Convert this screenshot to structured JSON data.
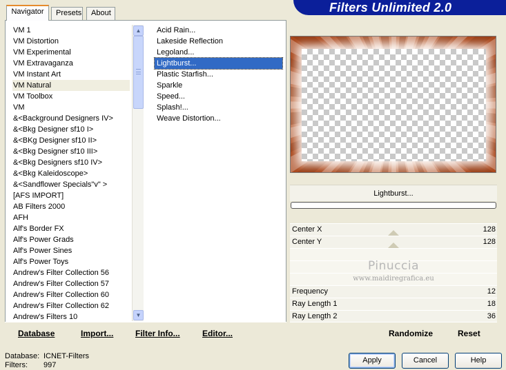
{
  "title": "Filters Unlimited 2.0",
  "tabs": [
    {
      "label": "Navigator",
      "active": true
    },
    {
      "label": "Presets",
      "active": false
    },
    {
      "label": "About",
      "active": false
    }
  ],
  "categories": [
    "VM 1",
    "VM Distortion",
    "VM Experimental",
    "VM Extravaganza",
    "VM Instant Art",
    "VM Natural",
    "VM Toolbox",
    "VM",
    "&<Background Designers IV>",
    "&<Bkg Designer sf10 I>",
    "&<BKg Designer sf10 II>",
    "&<Bkg Designer sf10 III>",
    "&<Bkg Designers sf10 IV>",
    "&<Bkg Kaleidoscope>",
    "&<Sandflower Specials\"v\" >",
    "[AFS IMPORT]",
    "AB Filters 2000",
    "AFH",
    "Alf's Border FX",
    "Alf's Power Grads",
    "Alf's Power Sines",
    "Alf's Power Toys",
    "Andrew's Filter Collection 56",
    "Andrew's Filter Collection 57",
    "Andrew's Filter Collection 60",
    "Andrew's Filter Collection 62",
    "Andrew's Filters 10"
  ],
  "selected_category": "VM Natural",
  "filters": [
    "Acid Rain...",
    "Lakeside Reflection",
    "Legoland...",
    "Lightburst...",
    "Plastic Starfish...",
    "Sparkle",
    "Speed...",
    "Splash!...",
    "Weave Distortion..."
  ],
  "selected_filter": "Lightburst...",
  "filter_name": "Lightburst...",
  "params": [
    {
      "label": "Center X",
      "value": "128",
      "level": 0.5
    },
    {
      "label": "Center Y",
      "value": "128",
      "level": 0.5
    },
    {
      "label": "Frequency",
      "value": "12"
    },
    {
      "label": "Ray Length 1",
      "value": "18"
    },
    {
      "label": "Ray Length 2",
      "value": "36"
    }
  ],
  "watermark": {
    "name": "Pinuccia",
    "url": "www.maidiregrafica.eu"
  },
  "left_toolbar": {
    "database": "Database",
    "import": "Import...",
    "filter_info": "Filter Info...",
    "editor": "Editor..."
  },
  "right_toolbar": {
    "randomize": "Randomize",
    "reset": "Reset"
  },
  "footer": {
    "database_label": "Database:",
    "database_value": "ICNET-Filters",
    "filters_label": "Filters:",
    "filters_value": "997"
  },
  "buttons": {
    "apply": "Apply",
    "cancel": "Cancel",
    "help": "Help"
  },
  "colors": {
    "banner": "#0b1f9a",
    "selection": "#316ac5",
    "preview_accent": "#b6501c"
  }
}
